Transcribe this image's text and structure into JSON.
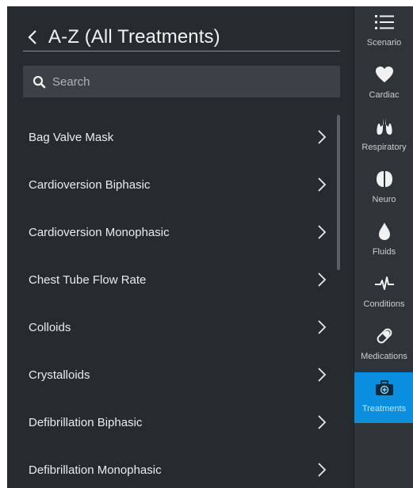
{
  "header": {
    "back_glyph": "<",
    "title": "A-Z (All Treatments)"
  },
  "search": {
    "placeholder": "Search",
    "value": ""
  },
  "treatments": [
    "Bag Valve Mask",
    "Cardioversion Biphasic",
    "Cardioversion Monophasic",
    "Chest Tube Flow Rate",
    "Colloids",
    "Crystalloids",
    "Defibrillation Biphasic",
    "Defibrillation Monophasic"
  ],
  "sidebar": {
    "items": [
      {
        "label": "Scenario",
        "icon": "list-icon",
        "active": false
      },
      {
        "label": "Cardiac",
        "icon": "heart-icon",
        "active": false
      },
      {
        "label": "Respiratory",
        "icon": "lungs-icon",
        "active": false
      },
      {
        "label": "Neuro",
        "icon": "brain-icon",
        "active": false
      },
      {
        "label": "Fluids",
        "icon": "drop-icon",
        "active": false
      },
      {
        "label": "Conditions",
        "icon": "pulse-icon",
        "active": false
      },
      {
        "label": "Medications",
        "icon": "pill-icon",
        "active": false
      },
      {
        "label": "Treatments",
        "icon": "medkit-icon",
        "active": true
      }
    ]
  },
  "colors": {
    "background": "#262b30",
    "rail_background": "#2e3438",
    "search_background": "#3b4146",
    "accent": "#0a8fe0",
    "text": "#e9ecee"
  }
}
